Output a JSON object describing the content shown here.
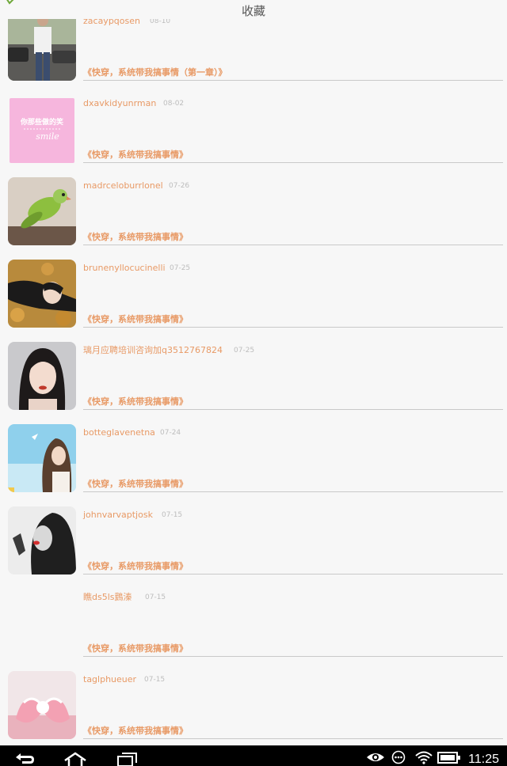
{
  "header": {
    "title": "收藏",
    "back_icon": "back-arrow-icon"
  },
  "favorites": [
    {
      "user": "zacaypqosen",
      "date": "08-10",
      "book": "《快穿，系统带我搞事情（第一章）》",
      "avatar": "man-standing-street-photo"
    },
    {
      "user": "dxavkidyunrman",
      "date": "08-02",
      "book": "《快穿，系统带我搞事情》",
      "avatar": "pink-text-graphic",
      "avatar_text": "你那些傲的笑",
      "avatar_script": "smile"
    },
    {
      "user": "madrceloburrlonel",
      "date": "07-26",
      "book": "《快穿，系统带我搞事情》",
      "avatar": "green-parrot-photo"
    },
    {
      "user": "brunenyllocucinelli",
      "date": "07-25",
      "book": "《快穿，系统带我搞事情》",
      "avatar": "woman-autumn-leaves-photo"
    },
    {
      "user": "璃月应聘培训咨询加q3512767824",
      "date": "07-25",
      "book": "《快穿，系统带我搞事情》",
      "avatar": "woman-portrait-illustration"
    },
    {
      "user": "botteglavenetna",
      "date": "07-24",
      "book": "《快穿，系统带我搞事情》",
      "avatar": "woman-blue-sky-illustration"
    },
    {
      "user": "johnvarvaptjosk",
      "date": "07-15",
      "book": "《快穿，系统带我搞事情》",
      "avatar": "woman-monochrome-red-lips-photo"
    },
    {
      "user": "瞧ds5ls鶢溱",
      "date": "07-15",
      "book": "《快穿，系统带我搞事情》",
      "avatar": "none"
    },
    {
      "user": "taglphueuer",
      "date": "07-15",
      "book": "《快穿，系统带我搞事情》",
      "avatar": "pink-bow-photo"
    }
  ],
  "system_bar": {
    "back": "back-icon",
    "home": "home-icon",
    "recents": "recent-apps-icon",
    "status_icons": [
      "eye-icon",
      "more-icon",
      "wifi-icon",
      "battery-icon"
    ],
    "time": "11:25"
  },
  "colors": {
    "accent": "#e89a66",
    "date": "#bdbdbd",
    "background": "#f7f7f7",
    "divider": "#c9c9c9"
  }
}
